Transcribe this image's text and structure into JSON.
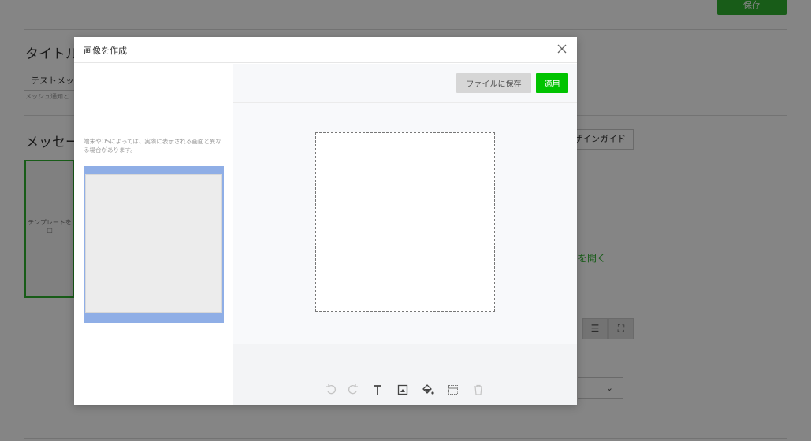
{
  "background": {
    "save_button": "保存",
    "title_section": "タイトル",
    "title_input_value": "テストメッ",
    "title_hint": "メッシュ通知と",
    "message_section": "メッセー",
    "template_box_text": "テンプレートを\n□",
    "design_guide_button": "ザインガイド",
    "green_link": "を開く"
  },
  "modal": {
    "title": "画像を作成",
    "close_icon": "close-icon",
    "left_notice": "端末やOSによっては、実際に表示される画面と異なる場合があります。",
    "toolbar": {
      "save_file_label": "ファイルに保存",
      "apply_label": "適用"
    },
    "tools": [
      {
        "name": "undo-icon"
      },
      {
        "name": "redo-icon"
      },
      {
        "name": "text-icon"
      },
      {
        "name": "image-icon"
      },
      {
        "name": "fill-icon"
      },
      {
        "name": "grid-icon"
      },
      {
        "name": "trash-icon"
      }
    ]
  },
  "colors": {
    "accent_green": "#00c300",
    "preview_blue": "#8faee6"
  }
}
